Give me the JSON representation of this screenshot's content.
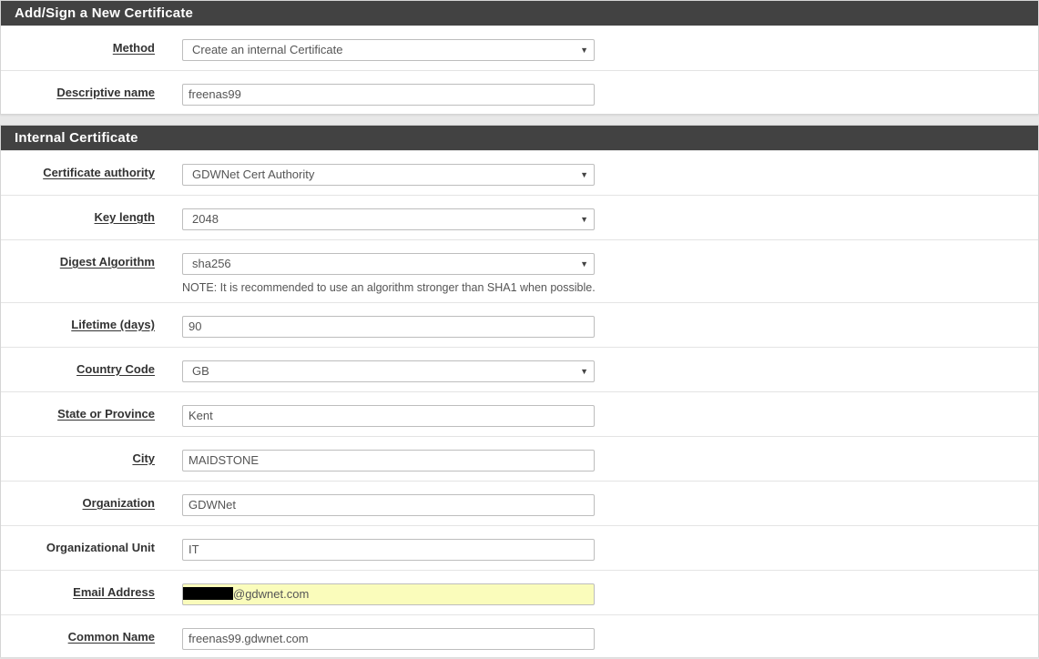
{
  "panel1": {
    "title": "Add/Sign a New Certificate",
    "method": {
      "label": "Method",
      "value": "Create an internal Certificate"
    },
    "descriptive_name": {
      "label": "Descriptive name",
      "value": "freenas99"
    }
  },
  "panel2": {
    "title": "Internal Certificate",
    "ca": {
      "label": "Certificate authority",
      "value": "GDWNet Cert Authority"
    },
    "key_length": {
      "label": "Key length",
      "value": "2048"
    },
    "digest": {
      "label": "Digest Algorithm",
      "value": "sha256",
      "note": "NOTE: It is recommended to use an algorithm stronger than SHA1 when possible."
    },
    "lifetime": {
      "label": "Lifetime (days)",
      "value": "90"
    },
    "country": {
      "label": "Country Code",
      "value": "GB"
    },
    "state": {
      "label": "State or Province",
      "value": "Kent"
    },
    "city": {
      "label": "City",
      "value": "MAIDSTONE"
    },
    "organization": {
      "label": "Organization",
      "value": "GDWNet"
    },
    "org_unit": {
      "label": "Organizational Unit",
      "value": "IT"
    },
    "email": {
      "label": "Email Address",
      "value_suffix": "@gdwnet.com"
    },
    "common_name": {
      "label": "Common Name",
      "value": "freenas99.gdwnet.com"
    }
  },
  "icons": {
    "caret": "▼"
  },
  "colors": {
    "heading_bg": "#424242",
    "autofill_bg": "#fafcbb"
  }
}
